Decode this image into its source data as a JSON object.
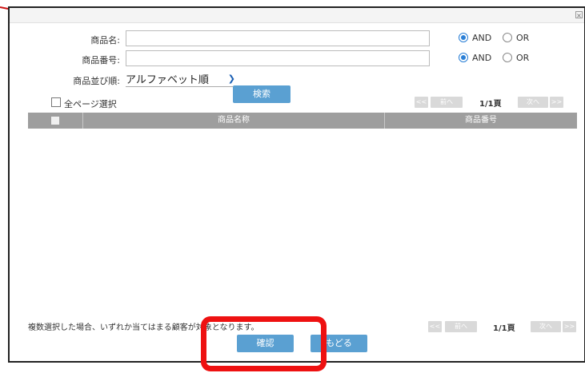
{
  "dialog": {
    "close_glyph": "×"
  },
  "form": {
    "product_name_label": "商品名:",
    "product_name_value": "",
    "product_number_label": "商品番号:",
    "product_number_value": "",
    "sort_label": "商品並び順:",
    "sort_selected": "アルファベット順",
    "and_label": "AND",
    "or_label": "OR",
    "search_button": "検索"
  },
  "list": {
    "select_all_label": "全ページ選択",
    "columns": [
      "商品名称",
      "商品番号"
    ],
    "rows": [],
    "note": "複数選択した場合、いずれか当てはまる顧客が対象となります。"
  },
  "pager": {
    "first": "<<",
    "prev": "前へ",
    "page": "1/1頁",
    "next": "次へ",
    "last": ">>"
  },
  "footer": {
    "confirm_button": "確認",
    "back_button": "もどる"
  },
  "colors": {
    "accent": "#5aa0d2",
    "header_gray": "#9e9e9e",
    "highlight_red": "#ee1111"
  }
}
